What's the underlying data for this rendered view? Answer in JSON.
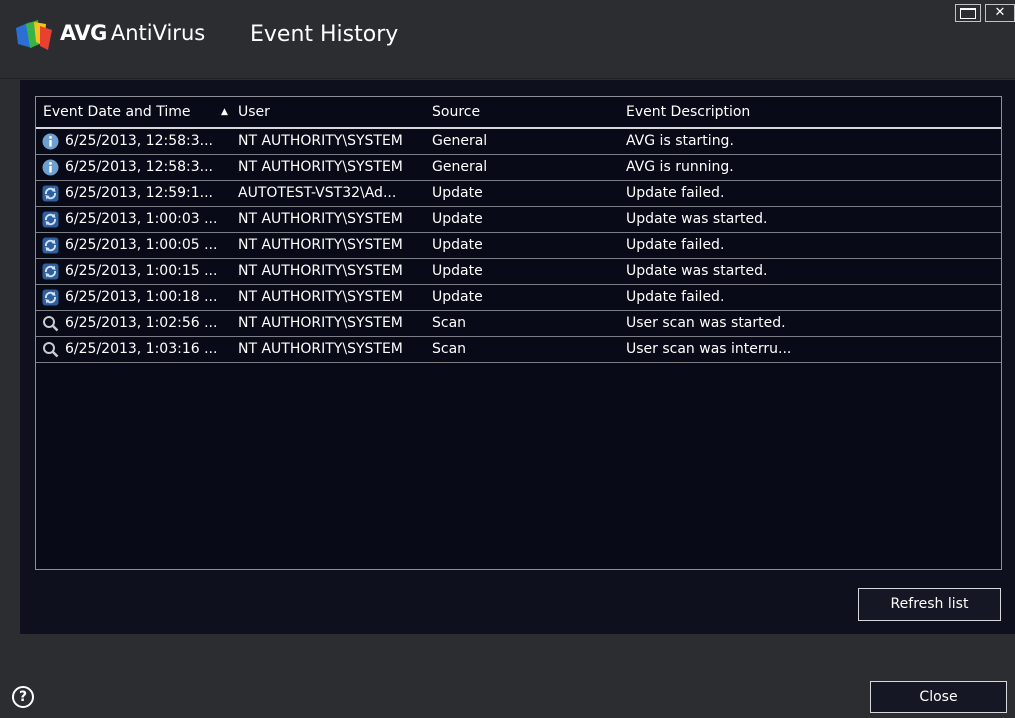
{
  "window": {
    "brand_name": "AVG",
    "product_name": "AntiVirus",
    "title": "Event History"
  },
  "table": {
    "columns": [
      "Event Date and Time",
      "User",
      "Source",
      "Event Description"
    ],
    "sorted_column_indicator": "▲",
    "rows": [
      {
        "icon": "info-icon",
        "date": "6/25/2013, 12:58:3...",
        "user": "NT AUTHORITY\\SYSTEM",
        "source": "General",
        "description": "AVG is starting."
      },
      {
        "icon": "info-icon",
        "date": "6/25/2013, 12:58:3...",
        "user": "NT AUTHORITY\\SYSTEM",
        "source": "General",
        "description": "AVG is running."
      },
      {
        "icon": "update-icon",
        "date": "6/25/2013, 12:59:1...",
        "user": "AUTOTEST-VST32\\Ad...",
        "source": "Update",
        "description": "Update failed."
      },
      {
        "icon": "update-icon",
        "date": "6/25/2013, 1:00:03 ...",
        "user": "NT AUTHORITY\\SYSTEM",
        "source": "Update",
        "description": "Update was started."
      },
      {
        "icon": "update-icon",
        "date": "6/25/2013, 1:00:05 ...",
        "user": "NT AUTHORITY\\SYSTEM",
        "source": "Update",
        "description": "Update failed."
      },
      {
        "icon": "update-icon",
        "date": "6/25/2013, 1:00:15 ...",
        "user": "NT AUTHORITY\\SYSTEM",
        "source": "Update",
        "description": "Update was started."
      },
      {
        "icon": "update-icon",
        "date": "6/25/2013, 1:00:18 ...",
        "user": "NT AUTHORITY\\SYSTEM",
        "source": "Update",
        "description": "Update failed."
      },
      {
        "icon": "search-icon",
        "date": "6/25/2013, 1:02:56 ...",
        "user": "NT AUTHORITY\\SYSTEM",
        "source": "Scan",
        "description": "User scan was started."
      },
      {
        "icon": "search-icon",
        "date": "6/25/2013, 1:03:16 ...",
        "user": "NT AUTHORITY\\SYSTEM",
        "source": "Scan",
        "description": "User scan was interru..."
      }
    ]
  },
  "buttons": {
    "refresh_label": "Refresh list",
    "close_label": "Close"
  },
  "help_icon": "help-icon",
  "colors": {
    "titlebar_bg": "#2b2d30",
    "panel_bg": "#0e101d",
    "info_icon": "#6e9fd1",
    "update_icon": "#6e9fd1",
    "search_icon": "#c8cbd0"
  }
}
